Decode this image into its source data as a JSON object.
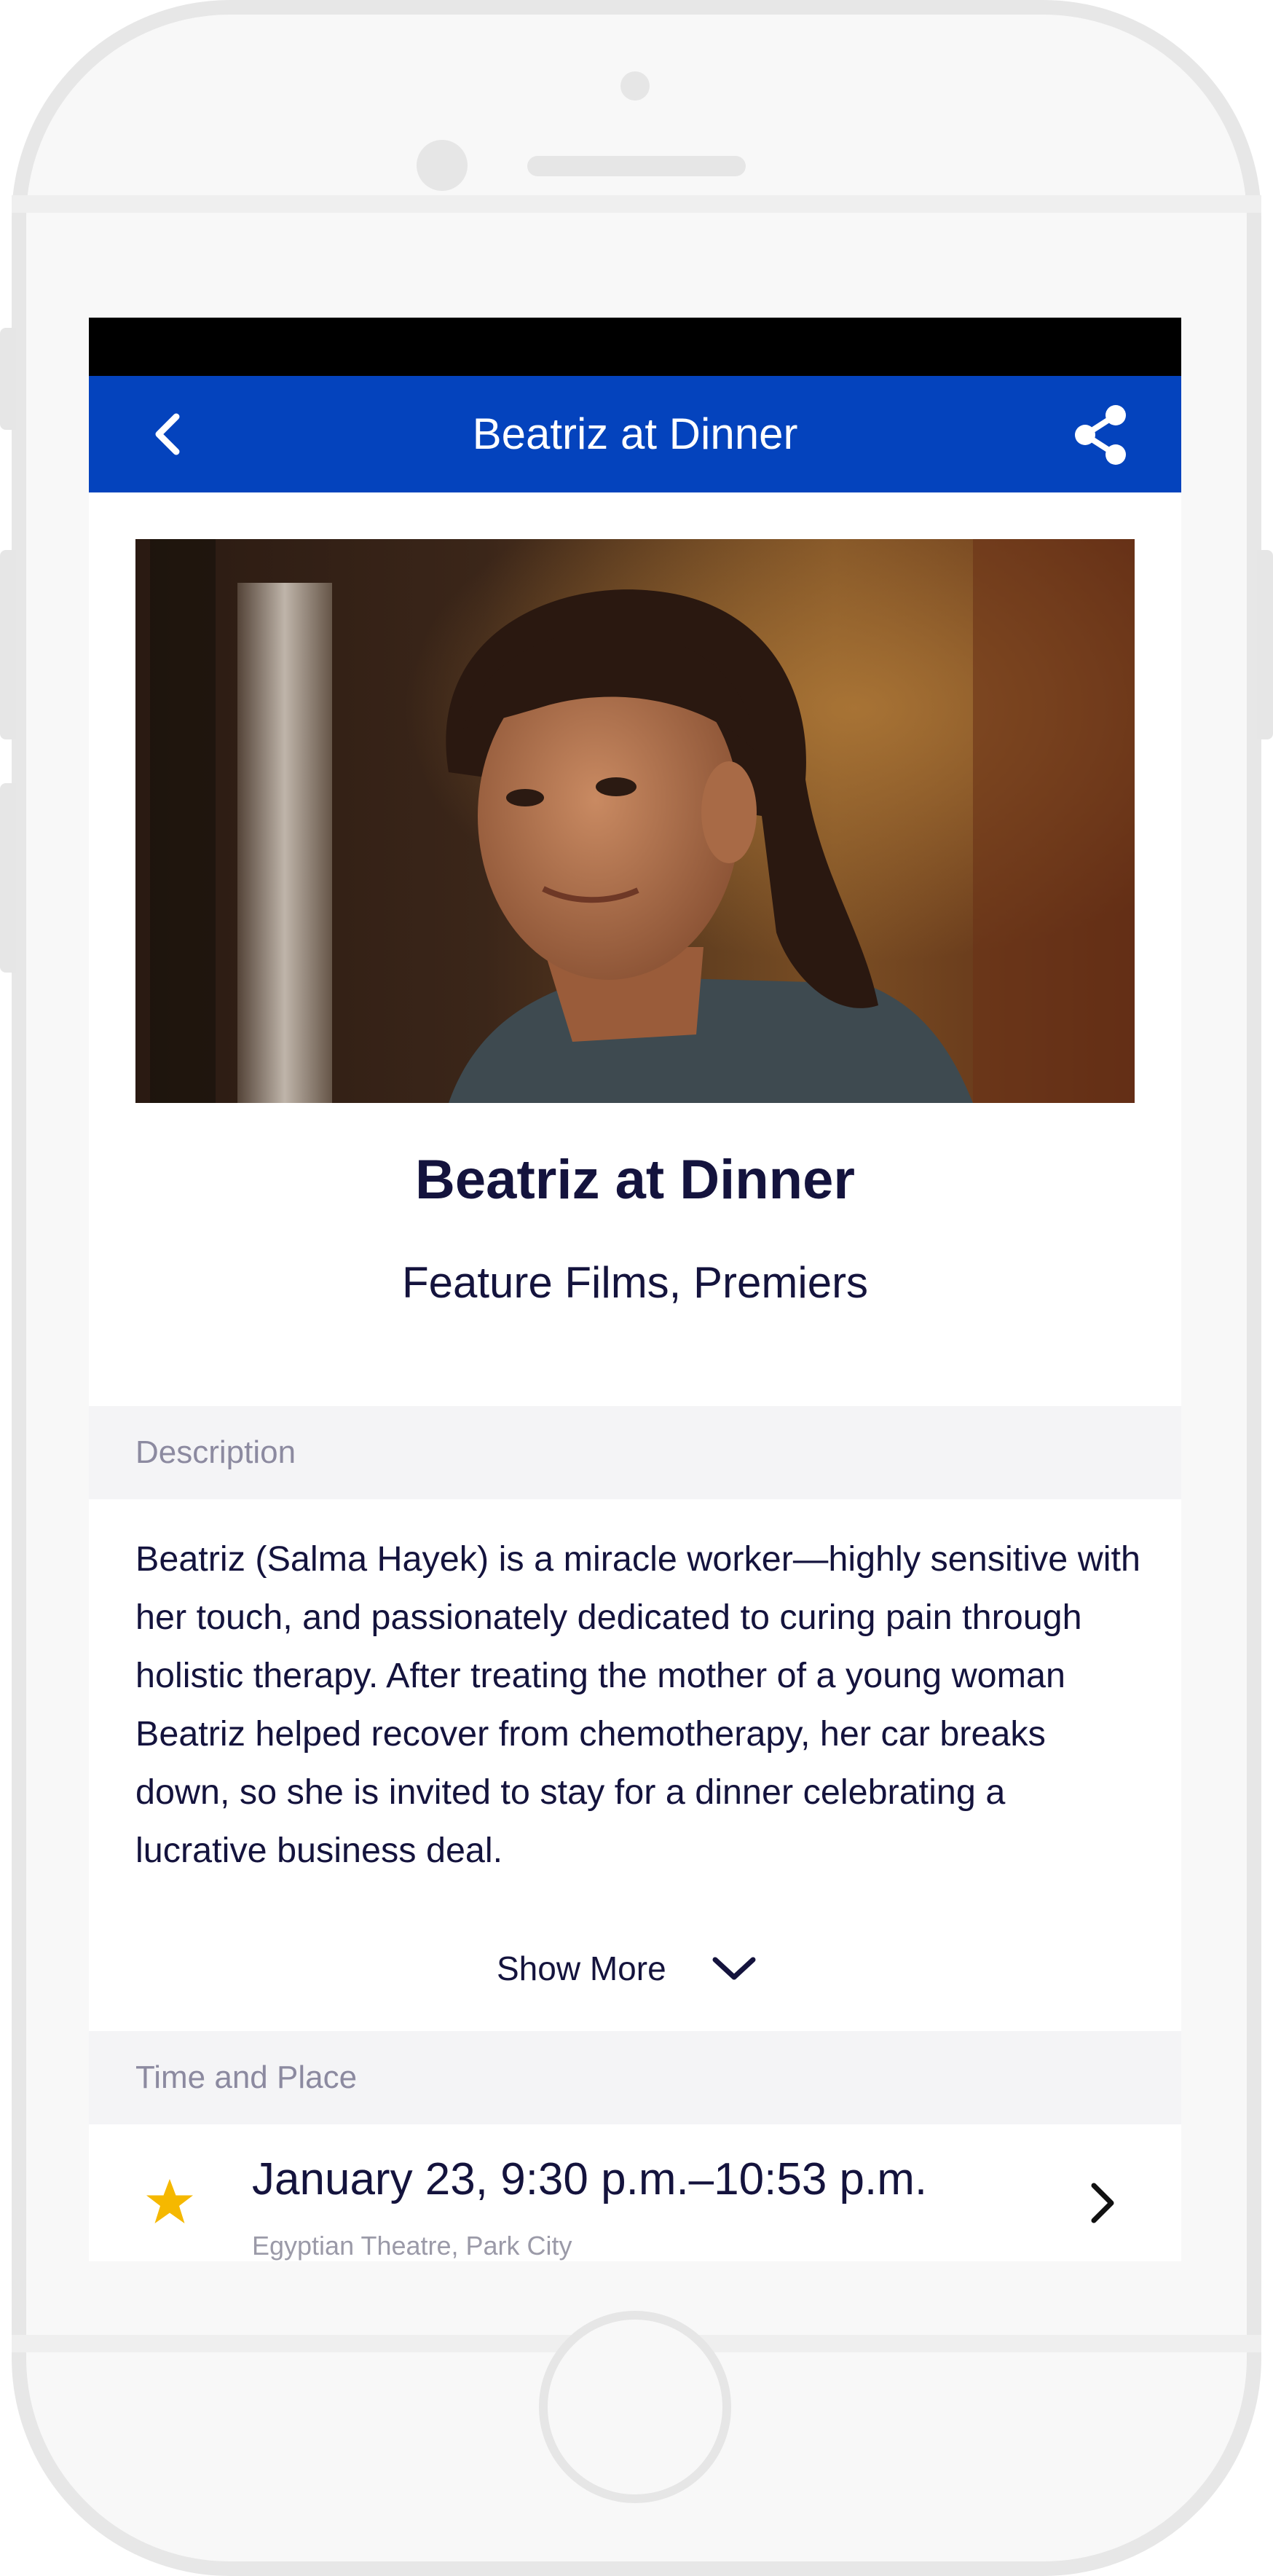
{
  "header": {
    "title": "Beatriz at Dinner"
  },
  "film": {
    "title": "Beatriz at Dinner",
    "categories": "Feature Films, Premiers"
  },
  "description": {
    "section_label": "Description",
    "text": "Beatriz (Salma Hayek) is a miracle worker—highly sensitive with her touch, and passionately dedicated to curing pain through holistic therapy. After treating the mother of a young woman Beatriz helped recover from chemotherapy, her car breaks down, so she is invited to stay for a dinner celebrating a lucrative business deal.",
    "show_more_label": "Show More"
  },
  "time_place": {
    "section_label": "Time and Place",
    "screenings": [
      {
        "time": "January 23, 9:30 p.m.–10:53 p.m.",
        "venue": "Egyptian Theatre, Park City",
        "starred": true
      }
    ]
  },
  "colors": {
    "header_bg": "#0443bd",
    "text_dark": "#14133d",
    "star": "#f5b800",
    "section_bg": "#f4f4f6"
  },
  "icons": {
    "back": "chevron-left-icon",
    "share": "share-icon",
    "show_more": "chevron-down-icon",
    "favorite": "star-icon",
    "row": "chevron-right-icon"
  }
}
